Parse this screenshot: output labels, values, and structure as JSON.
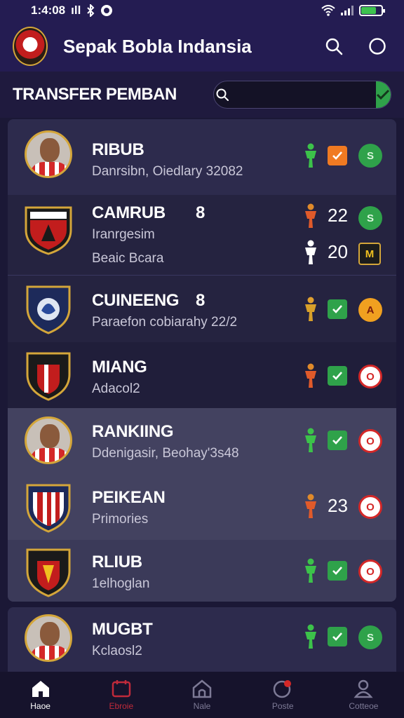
{
  "status": {
    "time": "1:4:08",
    "signal": "ıll",
    "battery_level": 0.75
  },
  "app": {
    "title": "Sepak Bobla Indansia"
  },
  "section": {
    "title": "TRANSFER PEMBAN",
    "search_placeholder": ""
  },
  "list": [
    {
      "name": "RIBUB",
      "subtitle": "Danrsibn, Oiedlary 32082",
      "status": "orange-check",
      "club_icon": "S"
    },
    {
      "name": "CAMRUB",
      "name_suffix": "8",
      "subtitle": "Iranrgesim",
      "subtitle2": "Beaic Bcara",
      "number": "22",
      "number2": "20",
      "club_icon": "S",
      "club_icon2": "M"
    },
    {
      "name": "CUINEENG",
      "name_suffix": "8",
      "subtitle": "Paraefon cobiarahy 22/2",
      "status": "green-check",
      "club_icon": "A"
    },
    {
      "name": "MIANG",
      "subtitle": "Adacol2",
      "status": "green-check",
      "club_icon": "O"
    },
    {
      "name": "RANKIING",
      "subtitle": "Ddenigasir, Beohay'3s48",
      "status": "green-check",
      "club_icon": "O"
    },
    {
      "name": "PEIKEAN",
      "subtitle": "Primories",
      "number": "23",
      "club_icon": "O"
    },
    {
      "name": "RLIUB",
      "subtitle": "1elhoglan",
      "status": "green-check",
      "club_icon": "O"
    },
    {
      "name": "MUGBT",
      "subtitle": "Kclaosl2",
      "status": "green-check",
      "club_icon": "S"
    }
  ],
  "nav": [
    {
      "label": "Haoe",
      "icon": "home-icon"
    },
    {
      "label": "Ebroie",
      "icon": "calendar-icon"
    },
    {
      "label": "Nale",
      "icon": "house-outline-icon"
    },
    {
      "label": "Poste",
      "icon": "notification-icon"
    },
    {
      "label": "Cotteoe",
      "icon": "profile-icon"
    }
  ],
  "colors": {
    "accent_green": "#2fa24a",
    "accent_orange": "#f07a22",
    "header_bg": "#241c52",
    "gold": "#d4a63a"
  }
}
